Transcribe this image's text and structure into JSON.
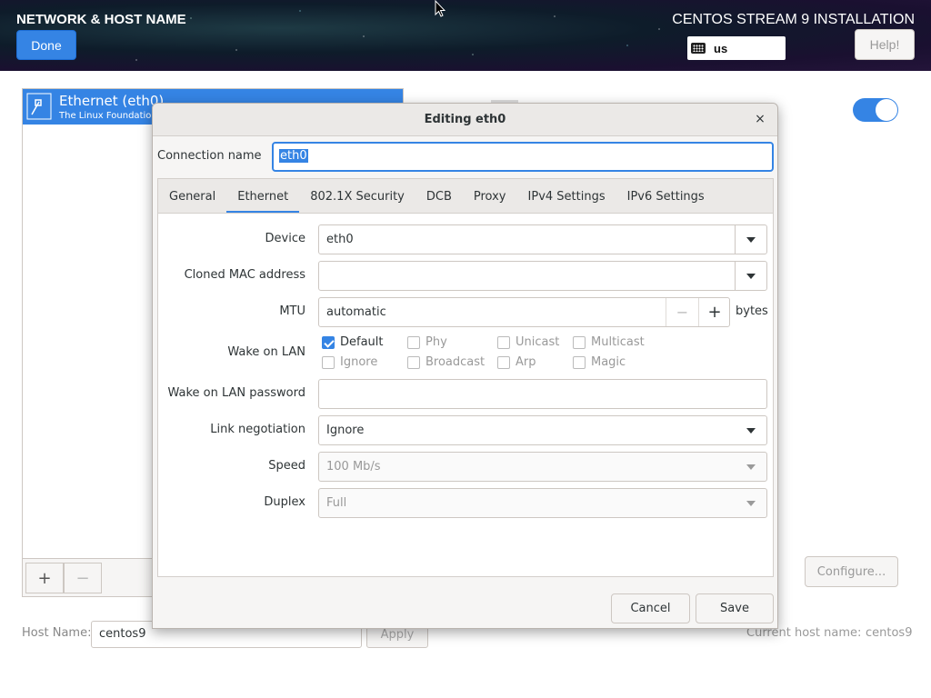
{
  "header": {
    "title": "NETWORK & HOST NAME",
    "product": "CENTOS STREAM 9 INSTALLATION",
    "done_label": "Done",
    "help_label": "Help!",
    "keyboard_layout": "us"
  },
  "hub": {
    "connection": {
      "name": "Ethernet (eth0)",
      "vendor": "The Linux Foundation"
    },
    "add_label": "+",
    "remove_label": "−",
    "toggle_on": true,
    "configure_label": "Configure...",
    "host_name_label": "Host Name:",
    "host_name_value": "centos9",
    "apply_label": "Apply",
    "current_host_label": "Current host name:",
    "current_host_value": "centos9"
  },
  "dialog": {
    "title": "Editing eth0",
    "close_glyph": "×",
    "connection_name_label": "Connection name",
    "connection_name_value": "eth0",
    "tabs": [
      {
        "label": "General"
      },
      {
        "label": "Ethernet",
        "active": true
      },
      {
        "label": "802.1X Security"
      },
      {
        "label": "DCB"
      },
      {
        "label": "Proxy"
      },
      {
        "label": "IPv4 Settings"
      },
      {
        "label": "IPv6 Settings"
      }
    ],
    "ethernet": {
      "device_label": "Device",
      "device_value": "eth0",
      "cloned_mac_label": "Cloned MAC address",
      "cloned_mac_value": "",
      "mtu_label": "MTU",
      "mtu_value": "automatic",
      "mtu_minus": "−",
      "mtu_plus": "+",
      "mtu_unit": "bytes",
      "wol_label": "Wake on LAN",
      "wol_options": [
        {
          "label": "Default",
          "checked": true
        },
        {
          "label": "Phy",
          "checked": false
        },
        {
          "label": "Unicast",
          "checked": false
        },
        {
          "label": "Multicast",
          "checked": false
        },
        {
          "label": "Ignore",
          "checked": false
        },
        {
          "label": "Broadcast",
          "checked": false
        },
        {
          "label": "Arp",
          "checked": false
        },
        {
          "label": "Magic",
          "checked": false
        }
      ],
      "wol_password_label": "Wake on LAN password",
      "wol_password_value": "",
      "link_negotiation_label": "Link negotiation",
      "link_negotiation_value": "Ignore",
      "speed_label": "Speed",
      "speed_value": "100 Mb/s",
      "duplex_label": "Duplex",
      "duplex_value": "Full"
    },
    "cancel_label": "Cancel",
    "save_label": "Save"
  },
  "colors": {
    "accent": "#3584e4",
    "dialog_bg": "#f6f5f4",
    "border": "#cdc7c2"
  }
}
